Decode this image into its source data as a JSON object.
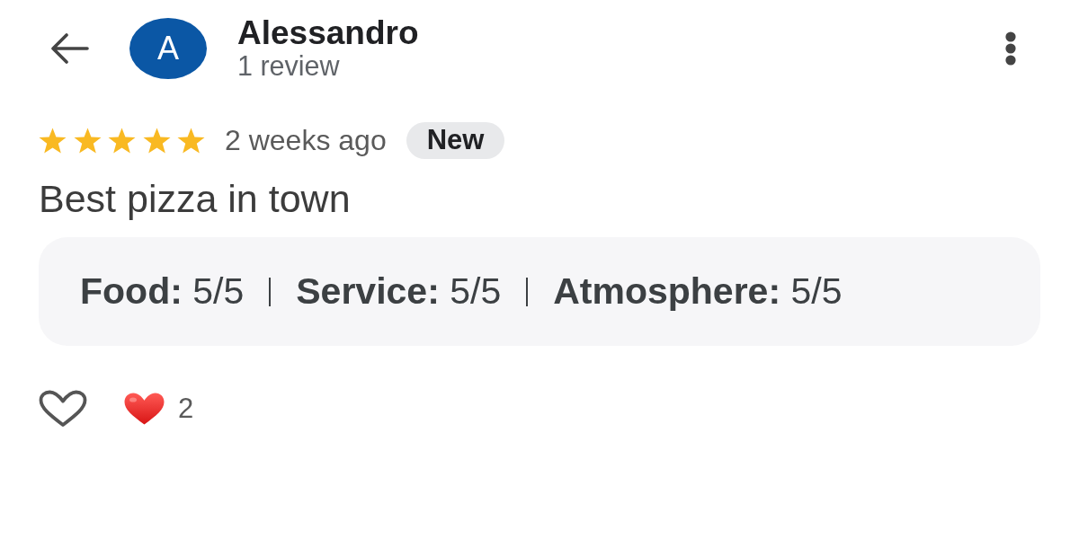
{
  "reviewer": {
    "initial": "A",
    "name": "Alessandro",
    "review_count": "1 review"
  },
  "review": {
    "stars": 5,
    "time": "2 weeks ago",
    "badge": "New",
    "text": "Best pizza in town",
    "details": [
      "**Food:** 5/5",
      "**Service:** 5/5",
      "**Atmosphere:** 5/5"
    ]
  },
  "reactions": {
    "liked": false,
    "count": "2"
  }
}
